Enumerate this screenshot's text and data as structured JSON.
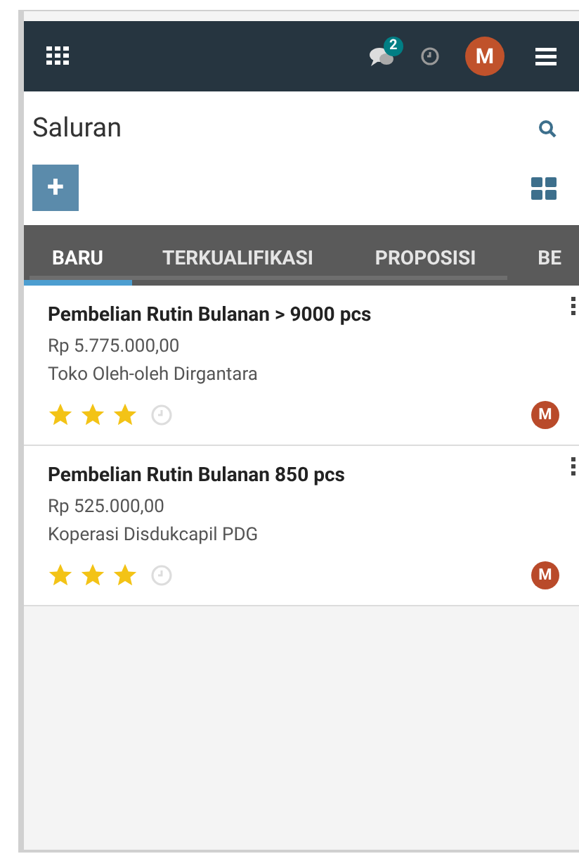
{
  "navbar": {
    "messages_badge": "2",
    "avatar": "M"
  },
  "title": "Saluran",
  "create_button": "+",
  "tabs": [
    {
      "label": "BARU",
      "selected": true
    },
    {
      "label": "TERKUALIFIKASI",
      "selected": false
    },
    {
      "label": "PROPOSISI",
      "selected": false
    },
    {
      "label": "BE",
      "selected": false
    }
  ],
  "cards": [
    {
      "title": "Pembelian Rutin Bulanan > 9000 pcs",
      "amount": "Rp 5.775.000,00",
      "customer": "Toko Oleh-oleh Dirgantara",
      "stars": 3,
      "avatar": "M"
    },
    {
      "title": "Pembelian Rutin Bulanan 850 pcs",
      "amount": "Rp 525.000,00",
      "customer": "Koperasi Disdukcapil PDG",
      "stars": 3,
      "avatar": "M"
    }
  ]
}
